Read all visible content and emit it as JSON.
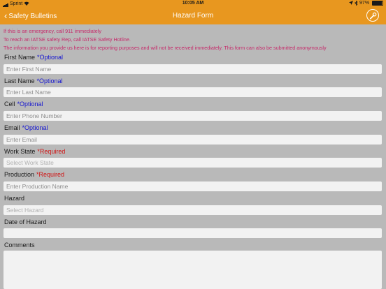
{
  "status_bar": {
    "carrier": "Sprint",
    "time": "10:05 AM",
    "battery": "97%"
  },
  "nav": {
    "back_label": "Safety Bulletins",
    "title": "Hazard Form",
    "accent_color": "#e8971f"
  },
  "notices": [
    "If this is an emergency, call 911 immediately",
    "To reach an IATSE safety Rep, call IATSE Safety Hotline.",
    "The information you provide us here is for reporting purposes and will not be received immediately. This form can also be submitted anonymously"
  ],
  "fields": {
    "first_name": {
      "label": "First Name",
      "tag": "*Optional",
      "placeholder": "Enter First Name"
    },
    "last_name": {
      "label": "Last Name",
      "tag": "*Optional",
      "placeholder": "Enter Last Name"
    },
    "cell": {
      "label": "Cell",
      "tag": "*Optional",
      "placeholder": "Enter Phone Number"
    },
    "email": {
      "label": "Email",
      "tag": "*Optional",
      "placeholder": "Enter Email"
    },
    "work_state": {
      "label": "Work State",
      "tag": "*Required",
      "placeholder": "Select Work State"
    },
    "production": {
      "label": "Production",
      "tag": "*Required",
      "placeholder": "Enter Production Name"
    },
    "hazard": {
      "label": "Hazard",
      "placeholder": "Select Hazard"
    },
    "date_of_hazard": {
      "label": "Date of Hazard",
      "placeholder": ""
    },
    "comments": {
      "label": "Comments"
    }
  },
  "icons": {
    "back": "chevron-left-icon",
    "settings": "wrench-icon",
    "wifi": "wifi-icon",
    "location": "location-arrow-icon",
    "bluetooth": "bluetooth-icon",
    "battery": "battery-icon"
  }
}
